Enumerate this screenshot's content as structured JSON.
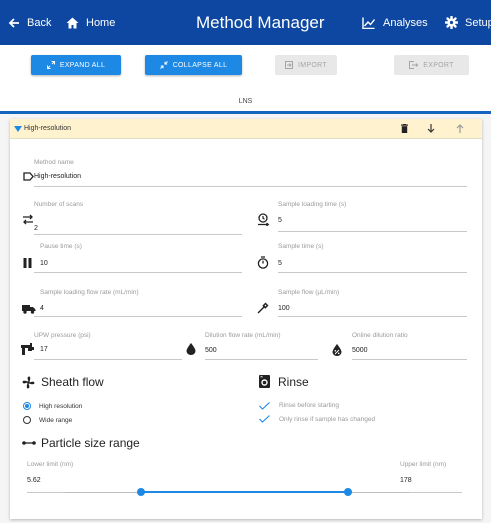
{
  "header": {
    "back_label": "Back",
    "home_label": "Home",
    "title": "Method Manager",
    "analyses_label": "Analyses",
    "setup_label": "Setup"
  },
  "toolbar": {
    "expand_all": "EXPAND ALL",
    "collapse_all": "COLLAPSE ALL",
    "import": "IMPORT",
    "export": "EXPORT",
    "group_label": "LNS"
  },
  "method": {
    "name": "High-resolution",
    "fields": {
      "method_name": {
        "label": "Method name",
        "value": "High-resolution"
      },
      "number_of_scans": {
        "label": "Number of scans",
        "value": "2"
      },
      "sample_loading_time": {
        "label": "Sample loading time (s)",
        "value": "5"
      },
      "pause_time": {
        "label": "Pause time (s)",
        "value": "10"
      },
      "sample_time": {
        "label": "Sample time (s)",
        "value": "5"
      },
      "sample_loading_flow_rate": {
        "label": "Sample loading flow rate (mL/min)",
        "value": "4"
      },
      "sample_flow": {
        "label": "Sample flow (µL/min)",
        "value": "100"
      },
      "upw_pressure": {
        "label": "UPW pressure (psi)",
        "value": "17"
      },
      "dilution_flow_rate": {
        "label": "Dilution flow rate (mL/min)",
        "value": "500"
      },
      "online_dilution_ratio": {
        "label": "Online dilution ratio",
        "value": "5000"
      }
    },
    "sheath_flow": {
      "title": "Sheath flow",
      "options": [
        "High resolution",
        "Wide range"
      ],
      "selected": "High resolution"
    },
    "rinse": {
      "title": "Rinse",
      "options": [
        "Rinse before starting",
        "Only rinse if sample has changed"
      ]
    },
    "particle_size_range": {
      "title": "Particle size range",
      "lower_label": "Lower limit (nm)",
      "lower_value": "5.62",
      "upper_label": "Upper limit (nm)",
      "upper_value": "178",
      "lower_fraction": 0.22,
      "upper_fraction": 0.82
    }
  },
  "colors": {
    "header": "#0d47a1",
    "primary_button": "#1e88e5",
    "accent": "#1e88e5",
    "card_header": "#fff3cf"
  }
}
